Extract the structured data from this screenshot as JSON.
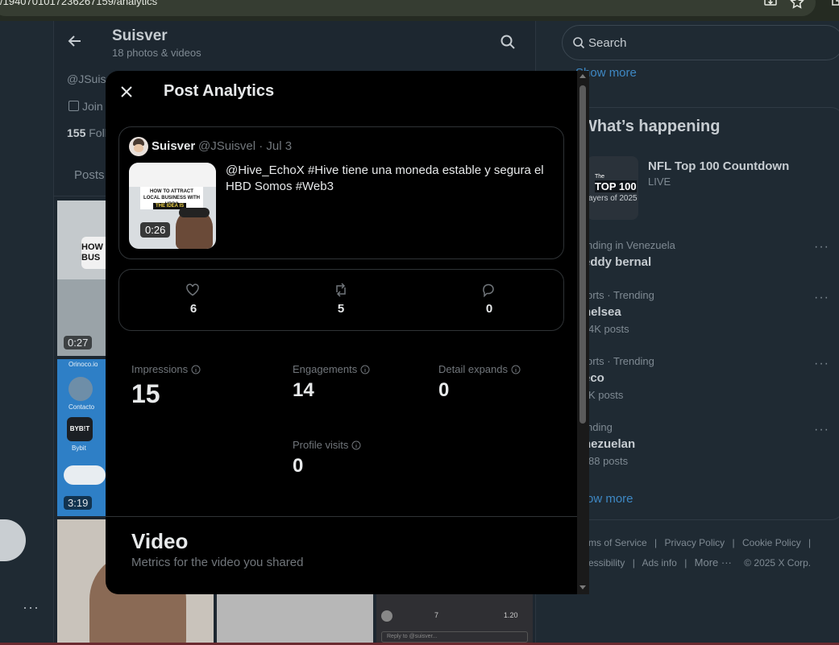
{
  "browser": {
    "url": "/1940701017236267159/analytics"
  },
  "background": {
    "profile_name": "Suisver",
    "profile_count": "18 photos & videos",
    "handle": "@JSuis",
    "joined": "Join",
    "following_count": "155",
    "following_label": "Foll",
    "posts_tab": "Posts",
    "thumb_durations": [
      "0:27",
      "3:19"
    ],
    "thumb_texts": {
      "how": "HOW",
      "bus": "BUS",
      "orinoco": "Orinoco.io",
      "contacto": "Contacto",
      "bybit_logo": "BYB!T",
      "bybit": "Bybit",
      "reply_placeholder": "Reply to @suisver...",
      "likes": "7",
      "views": "1.20"
    }
  },
  "right": {
    "search_placeholder": "Search",
    "show_more_top": "Show more",
    "whats_happening": "What’s happening",
    "nfl": {
      "title": "NFL Top 100 Countdown",
      "status": "LIVE",
      "img_top": "The",
      "img_main": "TOP 100",
      "img_sub": "ayers of 2025"
    },
    "trends": [
      {
        "category": "nding in Venezuela",
        "name": "eddy bernal",
        "posts": ""
      },
      {
        "category": "orts · Trending",
        "name": "helsea",
        "posts": "4K posts"
      },
      {
        "category": "orts · Trending",
        "name": "eco",
        "posts": "K posts"
      },
      {
        "category": "nding",
        "name": "nezuelan",
        "posts": "88 posts"
      }
    ],
    "more_dots": "···",
    "show_more_bottom": "ow more",
    "footer": {
      "terms": "ms of Service",
      "privacy": "Privacy Policy",
      "cookie": "Cookie Policy",
      "accessibility": "essibility",
      "ads": "Ads info",
      "more": "More ···",
      "copyright": "© 2025 X Corp.",
      "sep": "|"
    }
  },
  "modal": {
    "title": "Post Analytics",
    "post": {
      "author": "Suisver",
      "meta": "@JSuisvel · Jul 3",
      "text": "@Hive_EchoX  #Hive tiene una moneda estable y segura el HBD Somos #Web3",
      "duration": "0:26",
      "thumb_caption": "HOW TO ATTRACT LOCAL BUSINESS WITH HBD?",
      "thumb_sub": "THE IDEA IS"
    },
    "stats": {
      "likes": "6",
      "reposts": "5",
      "replies": "0"
    },
    "metrics": {
      "impressions_label": "Impressions",
      "impressions": "15",
      "engagements_label": "Engagements",
      "engagements": "14",
      "detail_expands_label": "Detail expands",
      "detail_expands": "0",
      "profile_visits_label": "Profile visits",
      "profile_visits": "0"
    },
    "video_section": {
      "title": "Video",
      "subtitle": "Metrics for the video you shared"
    }
  },
  "left_more": "···"
}
